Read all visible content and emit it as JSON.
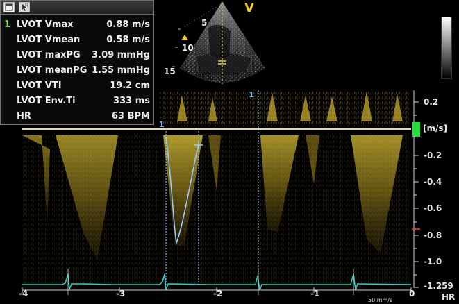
{
  "measurements": {
    "active_index": "1",
    "rows": [
      {
        "label": "LVOT Vmax",
        "value": "0.88 m/s"
      },
      {
        "label": "LVOT Vmean",
        "value": "0.58 m/s"
      },
      {
        "label": "LVOT maxPG",
        "value": "3.09 mmHg"
      },
      {
        "label": "LVOT meanPG",
        "value": "1.55 mmHg"
      },
      {
        "label": "LVOT VTI",
        "value": "19.2 cm"
      },
      {
        "label": "LVOT Env.Ti",
        "value": "333 ms"
      },
      {
        "label": "HR",
        "value": "63 BPM"
      }
    ]
  },
  "titlebar_icons": [
    "panel-window-icon",
    "cursor-select-icon"
  ],
  "sector": {
    "marker": "V",
    "depth_marks": [
      "5",
      "10",
      "15"
    ]
  },
  "velocity_scale": {
    "unit": "[m/s]",
    "ticks": [
      "0.2",
      "-0.2",
      "-0.4",
      "-0.6",
      "-0.8",
      "-1.0",
      "-1.2"
    ]
  },
  "time_axis": {
    "ticks": [
      "-4",
      "-3",
      "-2",
      "-1",
      "0"
    ]
  },
  "hr": {
    "value": "59",
    "label": "HR"
  },
  "sweep_speed": "50 mm/s",
  "cursor_labels": [
    "1",
    "1"
  ],
  "colors": {
    "spectrum": "#d9c23a",
    "baseline": "#e6dca0",
    "ecg": "#35c7c0",
    "caliper": "#8fb8ff",
    "active_index": "#7ddc52",
    "scale_marker": "#26e03a"
  }
}
